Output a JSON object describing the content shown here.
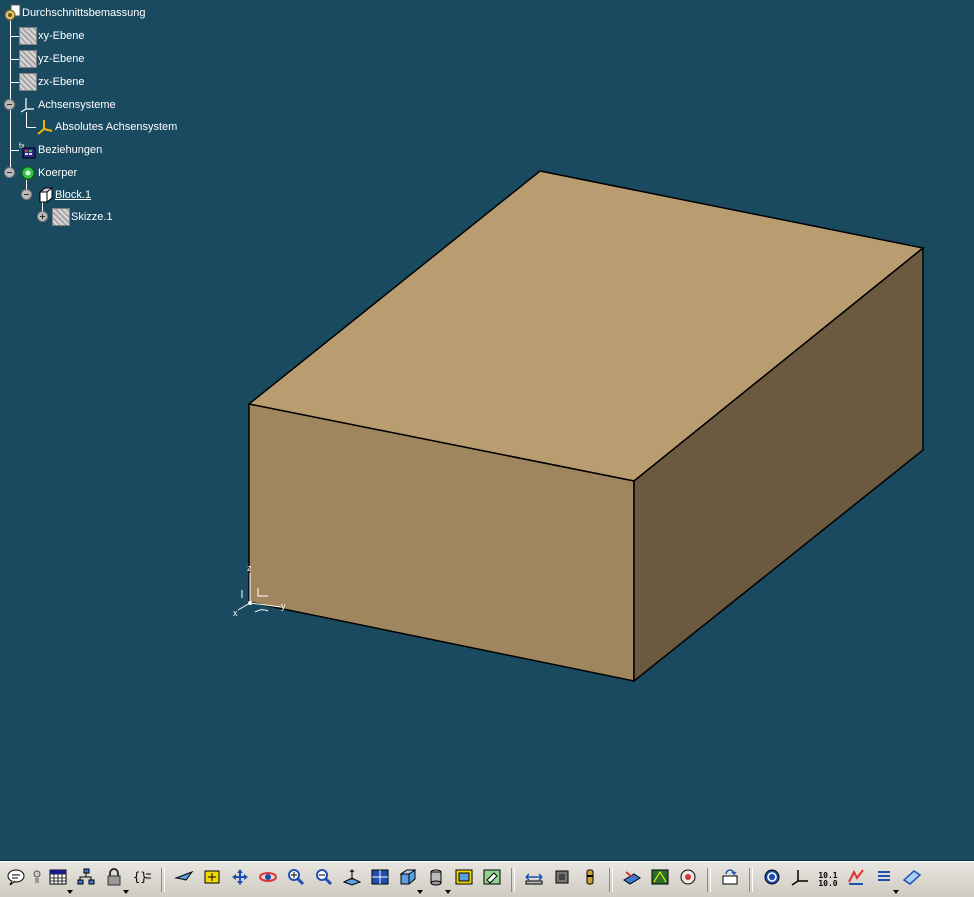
{
  "spec_tree": {
    "root": "Durchschnittsbemassung",
    "planes": [
      "xy-Ebene",
      "yz-Ebene",
      "zx-Ebene"
    ],
    "axis_systems": "Achsensysteme",
    "absolute_axis": "Absolutes Achsensystem",
    "relations": "Beziehungen",
    "body": "Koerper",
    "pad": "Block.1",
    "sketch": "Skizze.1"
  },
  "compass": {
    "x": "x",
    "y": "y",
    "z": "z"
  },
  "part": {
    "face_colors": {
      "top": "#b99d70",
      "front": "#a0865e",
      "side": "#6b5a3f"
    },
    "edge_color": "#000000"
  },
  "toolbar": {
    "scale_text_top": "10.1",
    "scale_text_bottom": "10.0",
    "tools": [
      "comment-icon",
      "grid-icon",
      "tree-expand-icon",
      "lock-icon",
      "formula-icon",
      "fly-mode-icon",
      "fit-all-icon",
      "pan-icon",
      "rotate-icon",
      "zoom-in-icon",
      "zoom-out-icon",
      "normal-view-icon",
      "multi-view-icon",
      "iso-view-icon",
      "shading-icon",
      "hide-show-icon",
      "swap-visible-icon",
      "measure-icon",
      "inertia-icon",
      "constraint-icon",
      "apply-material-icon",
      "render-icon",
      "texture-icon",
      "update-icon",
      "sketcher-icon",
      "axis-system-icon",
      "precision-icon",
      "analysis-icon",
      "list-icon",
      "plane-icon"
    ]
  }
}
